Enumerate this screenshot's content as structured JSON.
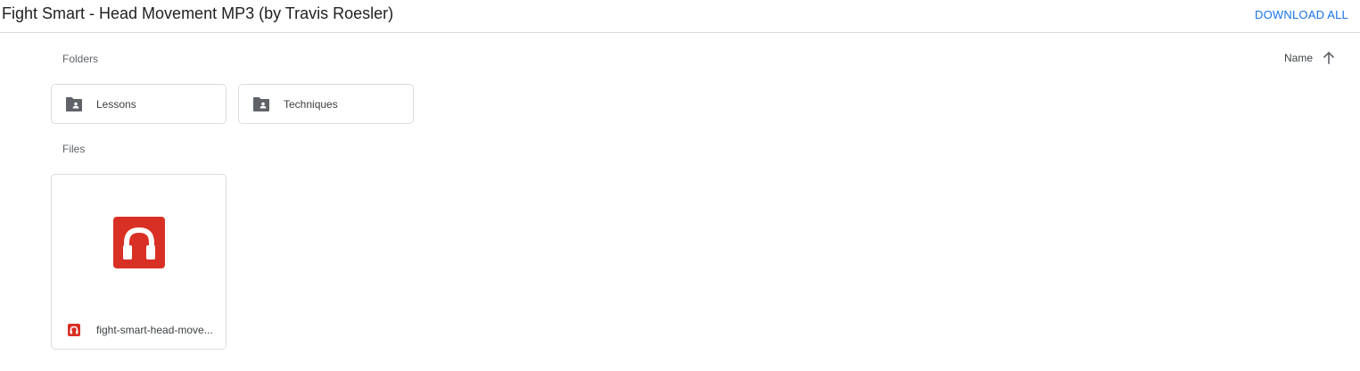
{
  "header": {
    "title": "Fight Smart - Head Movement MP3 (by Travis Roesler)",
    "download_all_label": "DOWNLOAD ALL"
  },
  "sections": {
    "folders_label": "Folders",
    "files_label": "Files"
  },
  "sort": {
    "label": "Name",
    "direction_icon": "arrow-up-icon"
  },
  "folders": [
    {
      "name": "Lessons",
      "icon": "shared-folder-icon"
    },
    {
      "name": "Techniques",
      "icon": "shared-folder-icon"
    }
  ],
  "files": [
    {
      "name": "fight-smart-head-move...",
      "icon": "audio-headphones-icon"
    }
  ],
  "colors": {
    "accent": "#1a73e8",
    "audio_icon": "#d93025",
    "folder_icon": "#5f6368",
    "border": "#dadce0"
  }
}
